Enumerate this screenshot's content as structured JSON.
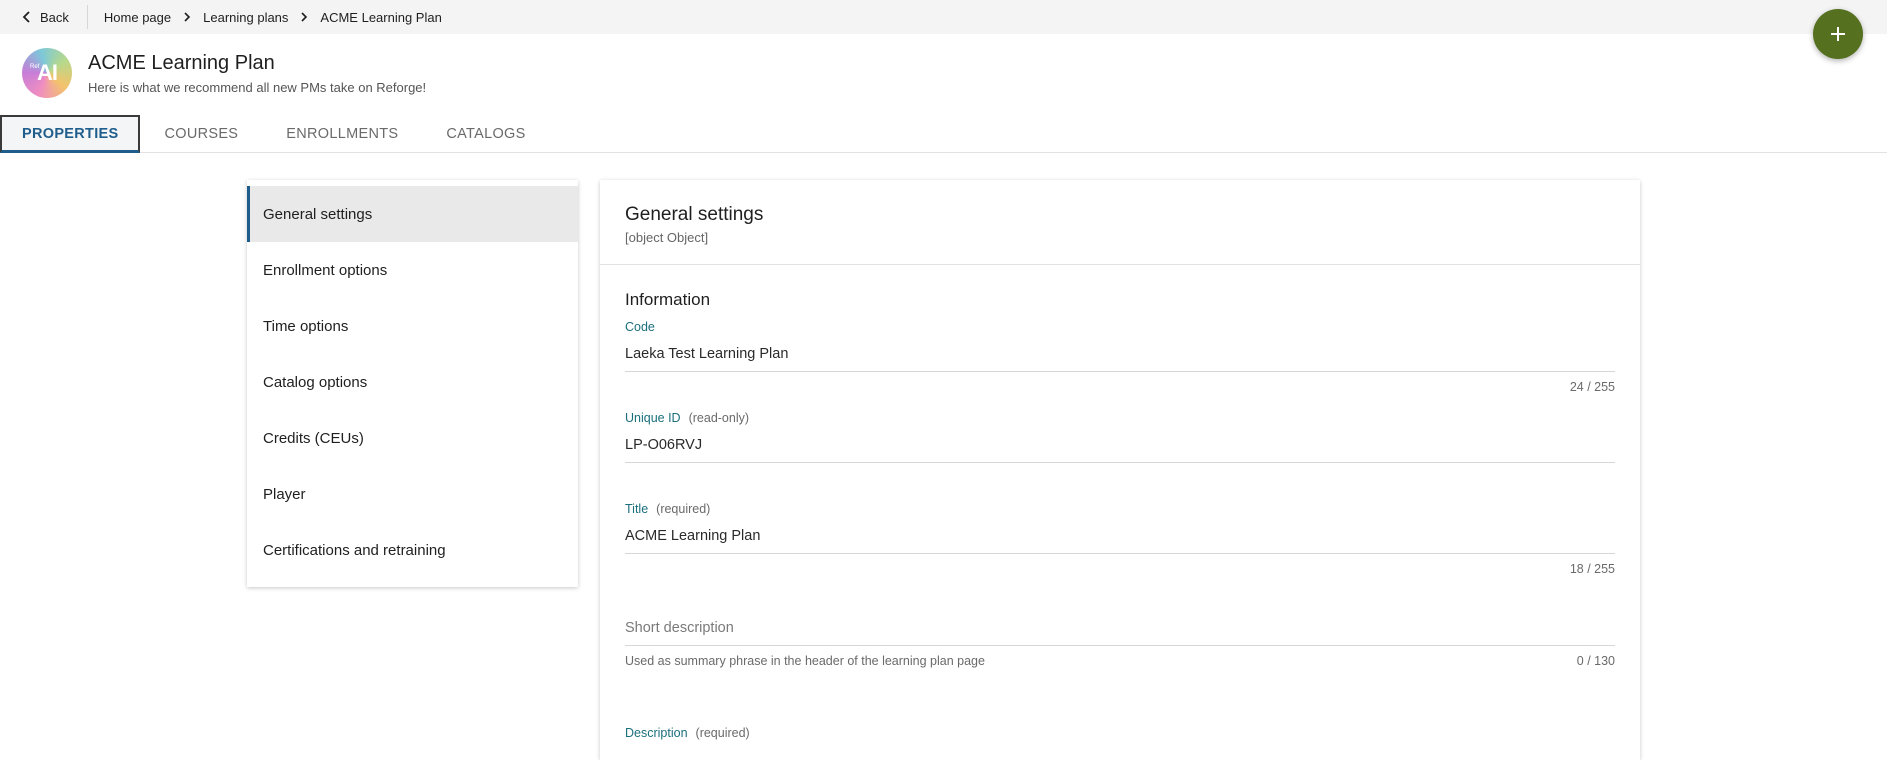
{
  "topbar": {
    "back_label": "Back",
    "breadcrumb": [
      "Home page",
      "Learning plans",
      "ACME Learning Plan"
    ]
  },
  "header": {
    "avatar_text": "AI",
    "avatar_small_text": "Ref",
    "title": "ACME Learning Plan",
    "subtitle": "Here is what we recommend all new PMs take on Reforge!"
  },
  "tabs": [
    "PROPERTIES",
    "COURSES",
    "ENROLLMENTS",
    "CATALOGS"
  ],
  "sidenav": {
    "items": [
      "General settings",
      "Enrollment options",
      "Time options",
      "Catalog options",
      "Credits (CEUs)",
      "Player",
      "Certifications and retraining"
    ]
  },
  "panel": {
    "title": "General settings",
    "description": {
      "label": "Description",
      "note": "(required)"
    },
    "section_title": "Information",
    "code": {
      "label": "Code",
      "value": "Laeka Test Learning Plan",
      "counter": "24 / 255"
    },
    "unique_id": {
      "label": "Unique ID",
      "note": "(read-only)",
      "value": "LP-O06RVJ"
    },
    "title_field": {
      "label": "Title",
      "note": "(required)",
      "value": "ACME Learning Plan",
      "counter": "18 / 255"
    },
    "short_description": {
      "placeholder": "Short description",
      "helper": "Used as summary phrase in the header of the learning plan page",
      "counter": "0 / 130"
    }
  },
  "colors": {
    "accent": "#1f5d8c",
    "fab": "#55701e",
    "label": "#1b6f7c"
  },
  "icons": {
    "back": "chevron-left-icon",
    "breadcrumb_sep": "chevron-right-icon",
    "fab": "plus-icon"
  }
}
